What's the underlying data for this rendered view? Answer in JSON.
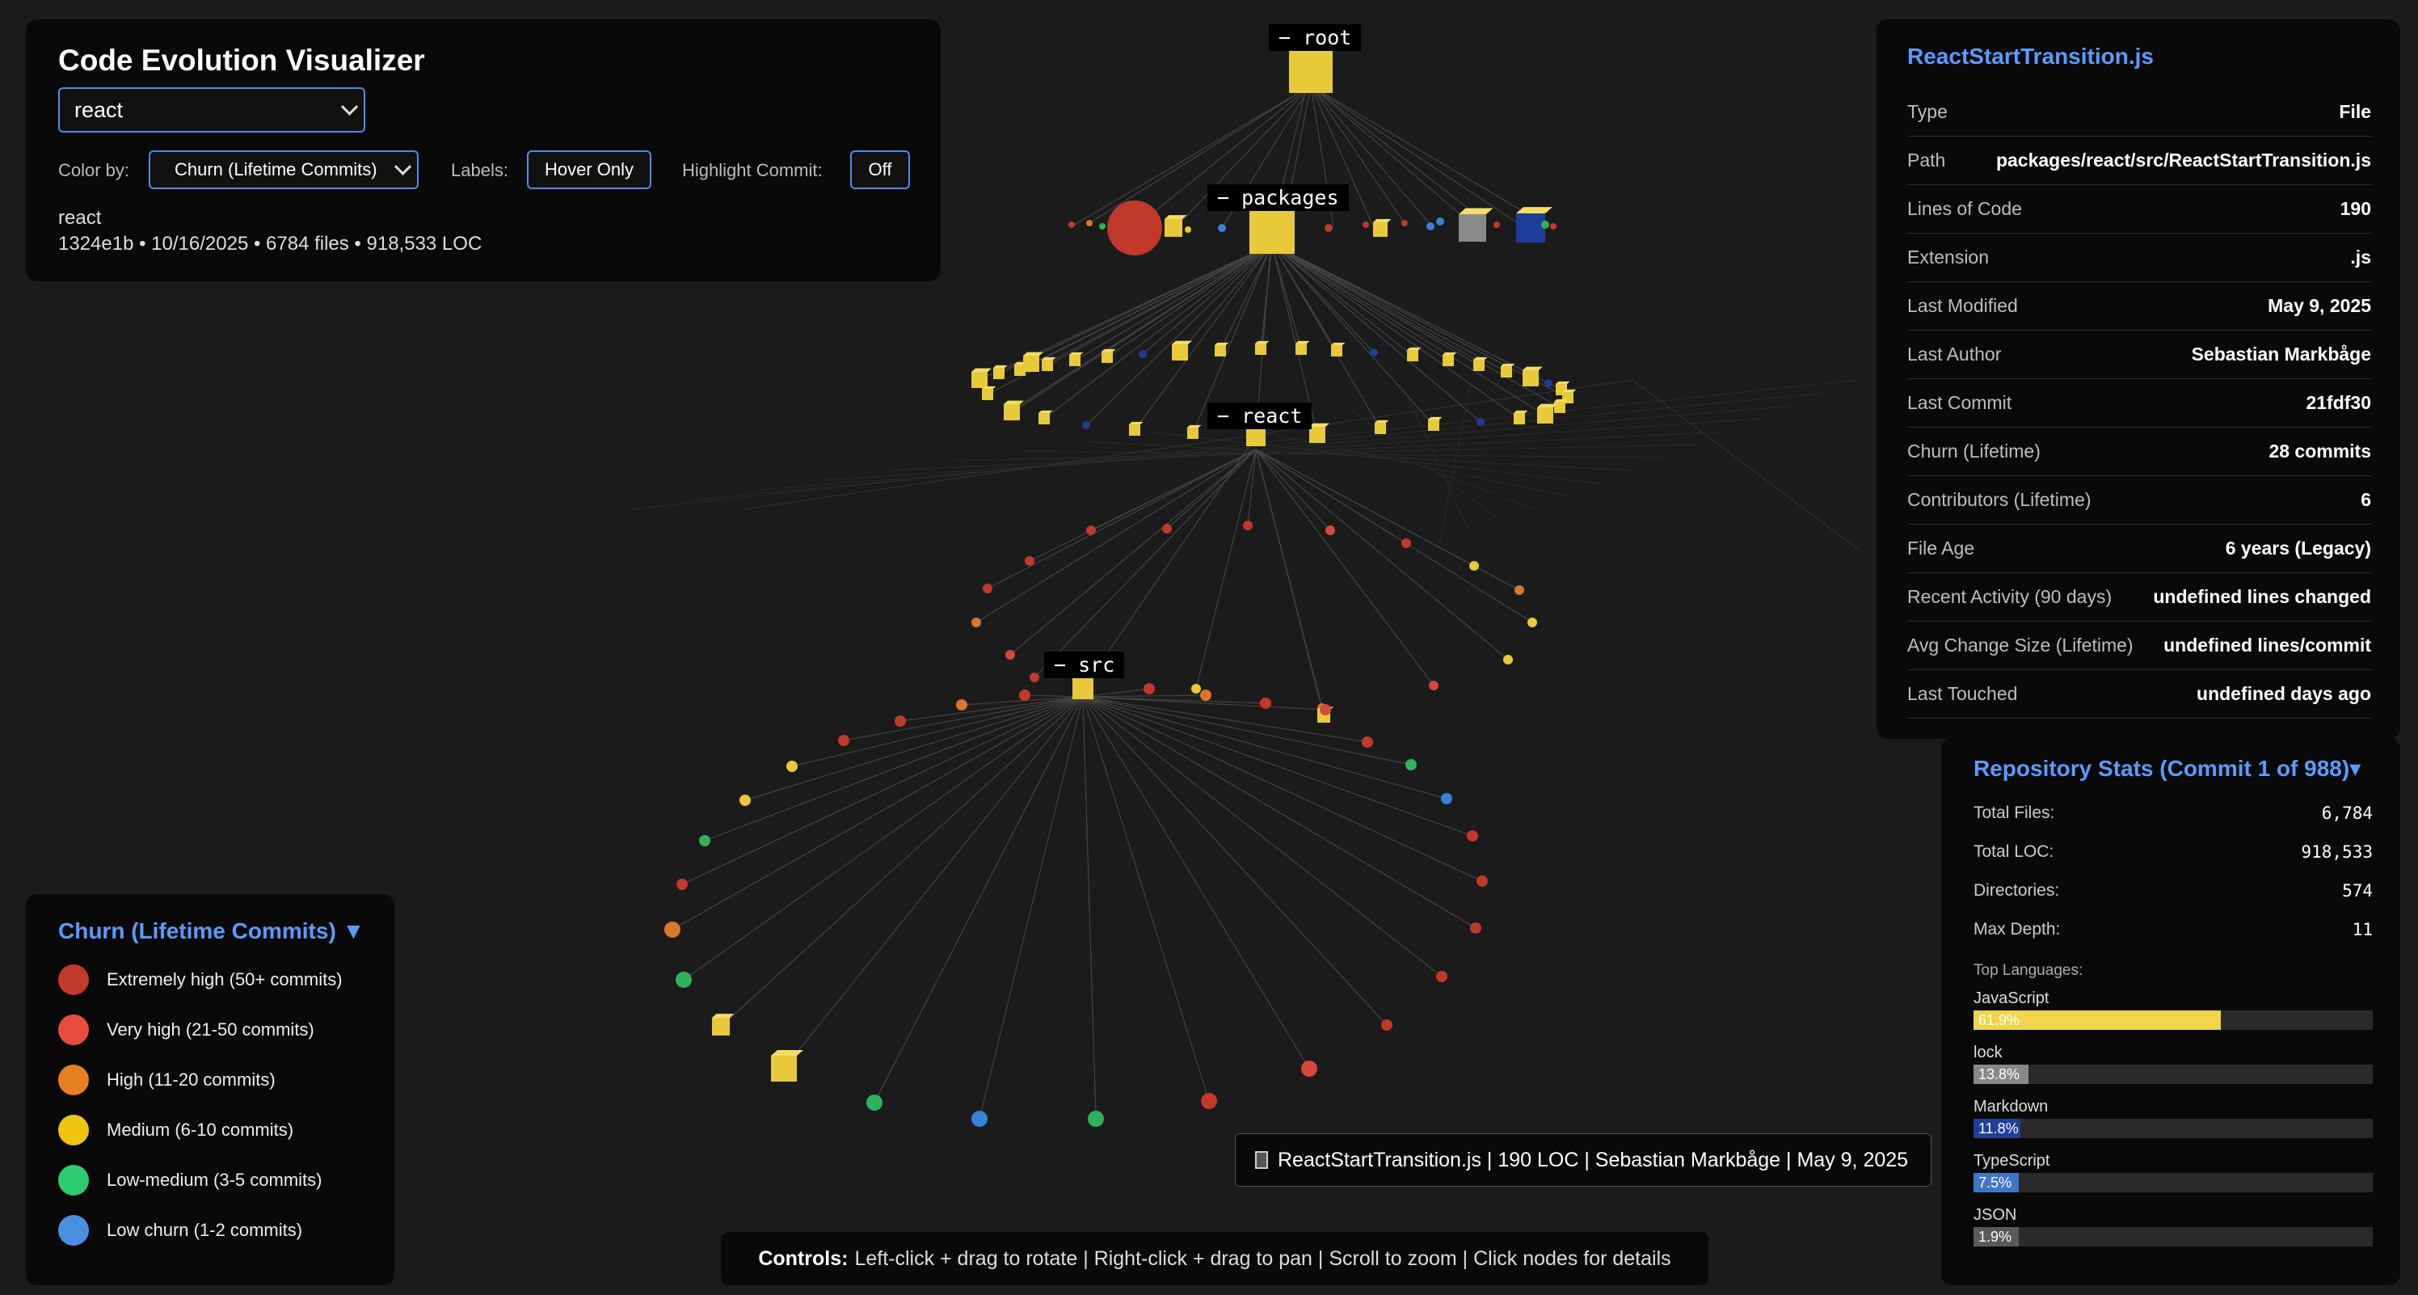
{
  "app": {
    "title": "Code Evolution Visualizer",
    "repo_selected": "react",
    "color_by_label": "Color by:",
    "color_by_value": "Churn (Lifetime Commits)",
    "labels_label": "Labels:",
    "labels_value": "Hover Only",
    "highlight_label": "Highlight Commit:",
    "highlight_value": "Off",
    "repo_name": "react",
    "repo_summary": "1324e1b • 10/16/2025 • 6784 files • 918,533 LOC"
  },
  "tree_labels": {
    "root": "− root",
    "packages": "− packages",
    "react": "− react",
    "src": "− src"
  },
  "legend": {
    "title": "Churn (Lifetime Commits) ▼",
    "items": [
      {
        "label": "Extremely high (50+ commits)",
        "color": "#c0392b"
      },
      {
        "label": "Very high (21-50 commits)",
        "color": "#e74c3c"
      },
      {
        "label": "High (11-20 commits)",
        "color": "#e67e22"
      },
      {
        "label": "Medium (6-10 commits)",
        "color": "#f1c40f"
      },
      {
        "label": "Low-medium (3-5 commits)",
        "color": "#2ecc71"
      },
      {
        "label": "Low churn (1-2 commits)",
        "color": "#4a90e2"
      }
    ]
  },
  "details": {
    "file_name": "ReactStartTransition.js",
    "rows": [
      {
        "key": "Type",
        "value": "File"
      },
      {
        "key": "Path",
        "value": "packages/react/src/ReactStartTransition.js"
      },
      {
        "key": "Lines of Code",
        "value": "190"
      },
      {
        "key": "Extension",
        "value": ".js"
      },
      {
        "key": "Last Modified",
        "value": "May 9, 2025"
      },
      {
        "key": "Last Author",
        "value": "Sebastian Markbåge"
      },
      {
        "key": "Last Commit",
        "value": "21fdf30"
      },
      {
        "key": "Churn (Lifetime)",
        "value": "28 commits"
      },
      {
        "key": "Contributors (Lifetime)",
        "value": "6"
      },
      {
        "key": "File Age",
        "value": "6 years (Legacy)"
      },
      {
        "key": "Recent Activity (90 days)",
        "value": "undefined lines changed"
      },
      {
        "key": "Avg Change Size (Lifetime)",
        "value": "undefined lines/commit"
      },
      {
        "key": "Last Touched",
        "value": "undefined days ago"
      }
    ]
  },
  "stats": {
    "title": "Repository Stats (Commit 1 of 988)▾",
    "rows": [
      {
        "key": "Total Files:",
        "value": "6,784"
      },
      {
        "key": "Total LOC:",
        "value": "918,533"
      },
      {
        "key": "Directories:",
        "value": "574"
      },
      {
        "key": "Max Depth:",
        "value": "11"
      }
    ],
    "languages_label": "Top Languages:",
    "languages": [
      {
        "name": "JavaScript",
        "pct": "61.9%",
        "value": 61.9,
        "color": "#f1d54a"
      },
      {
        "name": "lock",
        "pct": "13.8%",
        "value": 13.8,
        "color": "#888888"
      },
      {
        "name": "Markdown",
        "pct": "11.8%",
        "value": 11.8,
        "color": "#1f3f9a"
      },
      {
        "name": "TypeScript",
        "pct": "7.5%",
        "value": 7.5,
        "color": "#3f76c8"
      },
      {
        "name": "JSON",
        "pct": "1.9%",
        "value": 1.9,
        "color": "#5a5a5a"
      }
    ]
  },
  "tooltip": {
    "text": "ReactStartTransition.js | 190 LOC | Sebastian Markbåge | May 9, 2025"
  },
  "hint": {
    "bold": "Controls:",
    "text": "Left-click + drag to rotate | Right-click + drag to pan | Scroll to zoom | Click nodes for details"
  },
  "colors": {
    "accent": "#4a8cf0",
    "title_blue": "#5a9cff",
    "dir_yellow": "#e8c93a"
  }
}
